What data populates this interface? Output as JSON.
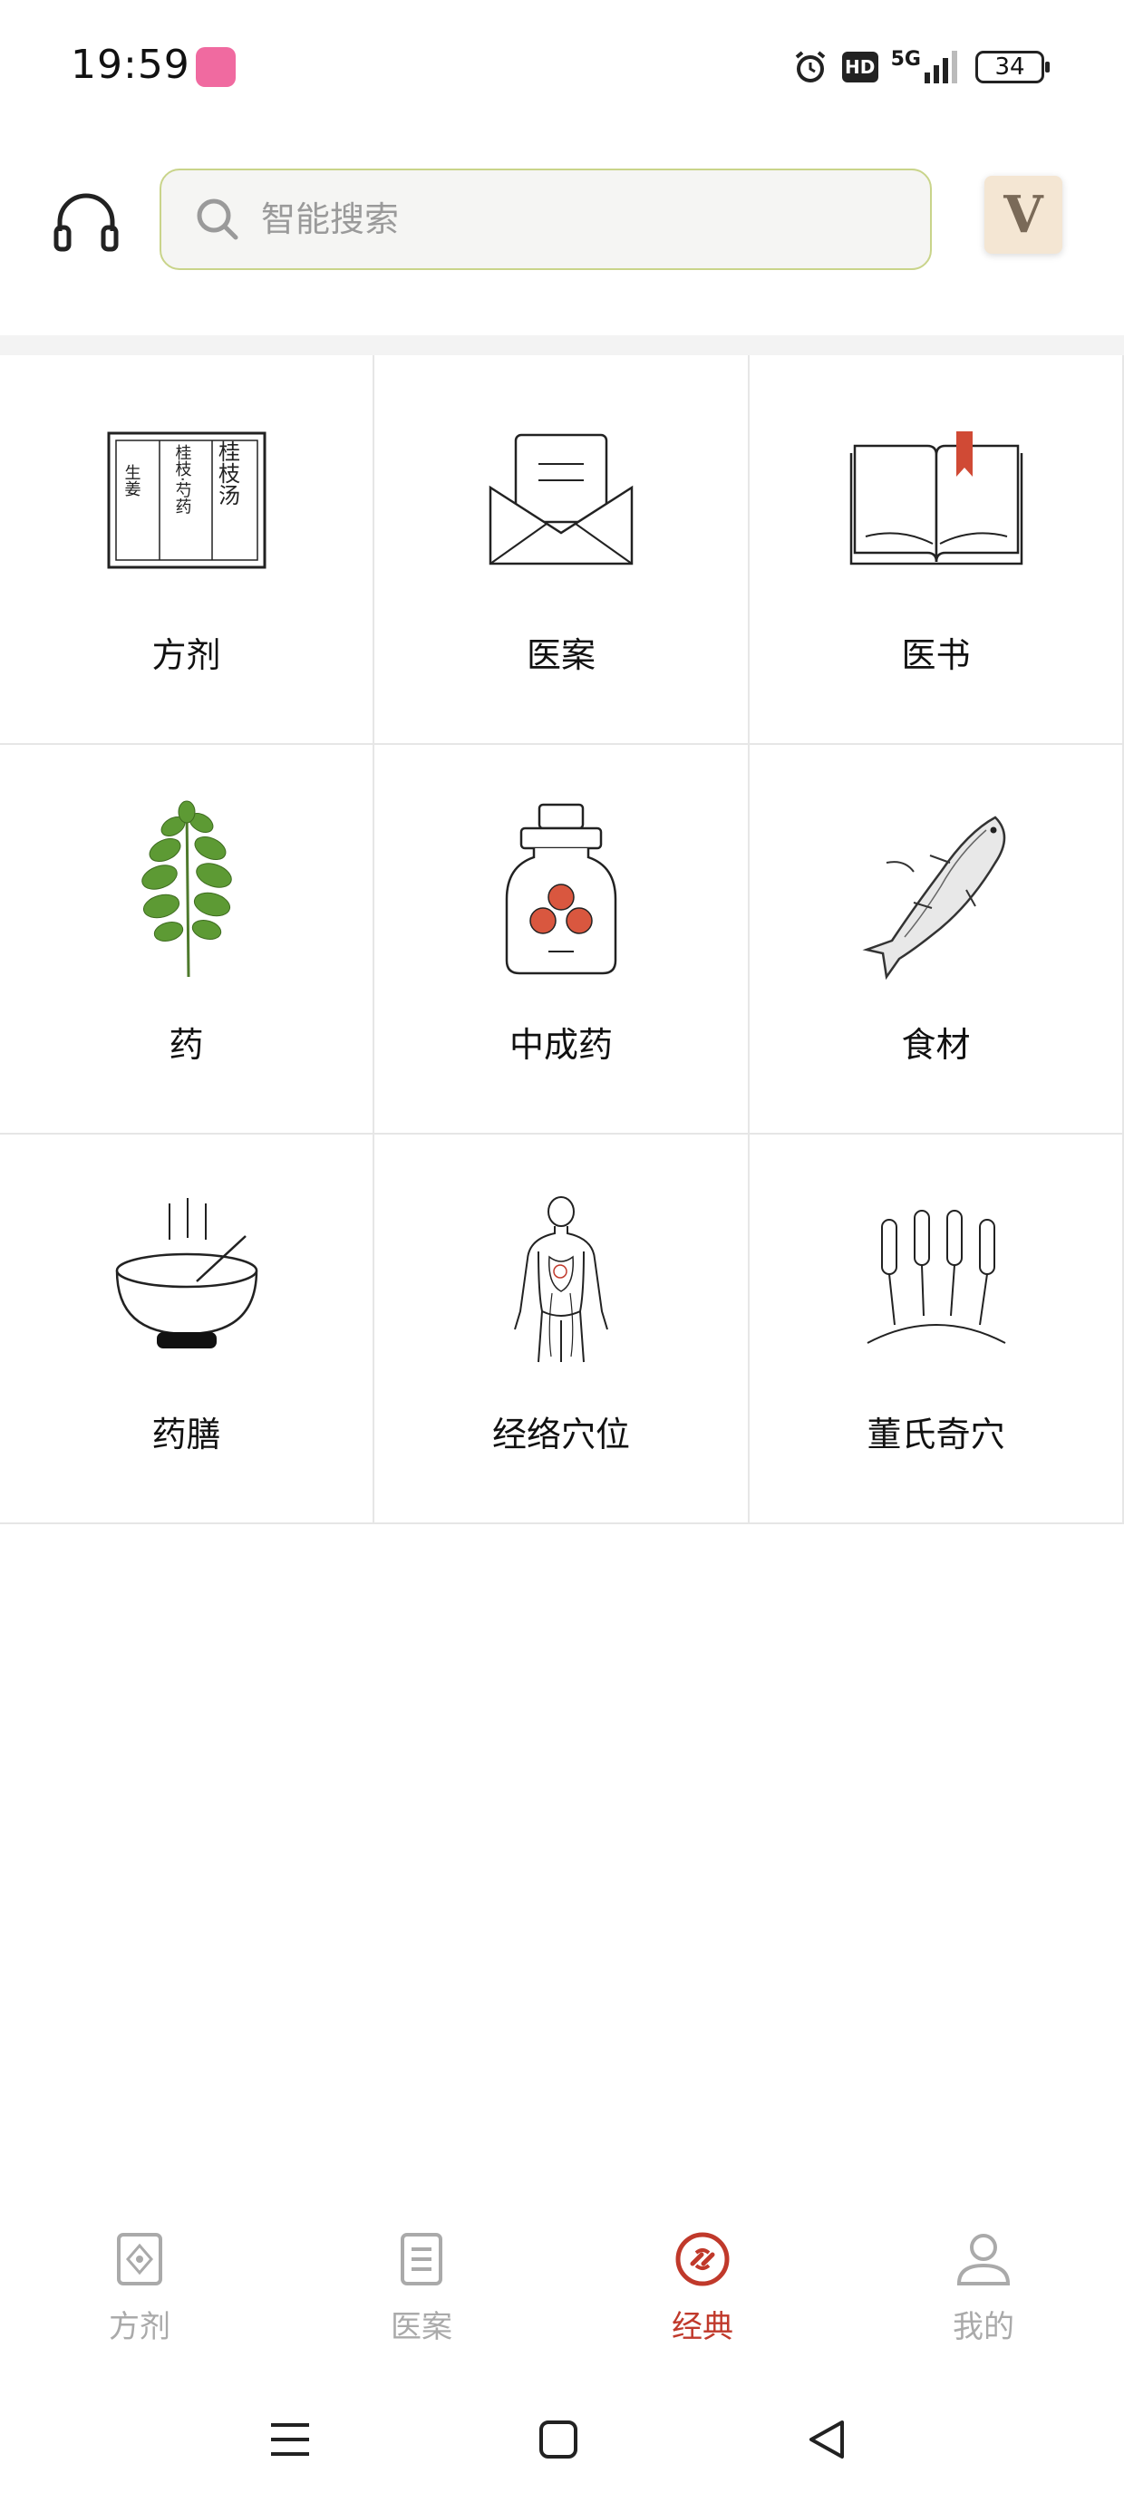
{
  "status_bar": {
    "time": "19:59",
    "battery": "34",
    "network": "5G",
    "hd": "HD"
  },
  "header": {
    "search_placeholder": "智能搜索",
    "vip_label": "V"
  },
  "grid": {
    "items": [
      {
        "label": "方剂",
        "icon": "prescription-card-icon"
      },
      {
        "label": "医案",
        "icon": "envelope-letter-icon"
      },
      {
        "label": "医书",
        "icon": "open-book-icon"
      },
      {
        "label": "药",
        "icon": "herb-plant-icon"
      },
      {
        "label": "中成药",
        "icon": "pill-jar-icon"
      },
      {
        "label": "食材",
        "icon": "fish-icon"
      },
      {
        "label": "药膳",
        "icon": "soup-bowl-icon"
      },
      {
        "label": "经络穴位",
        "icon": "human-meridian-icon"
      },
      {
        "label": "董氏奇穴",
        "icon": "acupuncture-needles-icon"
      }
    ],
    "card_text": {
      "title": "桂枝汤",
      "line1": "桂枝·芍药",
      "line2": "生姜"
    }
  },
  "bottom_nav": {
    "items": [
      {
        "label": "方剂",
        "icon": "prescription-tab-icon",
        "active": false
      },
      {
        "label": "医案",
        "icon": "document-tab-icon",
        "active": false
      },
      {
        "label": "经典",
        "icon": "classic-tab-icon",
        "active": true
      },
      {
        "label": "我的",
        "icon": "profile-tab-icon",
        "active": false
      }
    ]
  },
  "colors": {
    "accent": "#c0392b",
    "search_border": "#c9d48a",
    "inactive": "#aaaaaa"
  }
}
